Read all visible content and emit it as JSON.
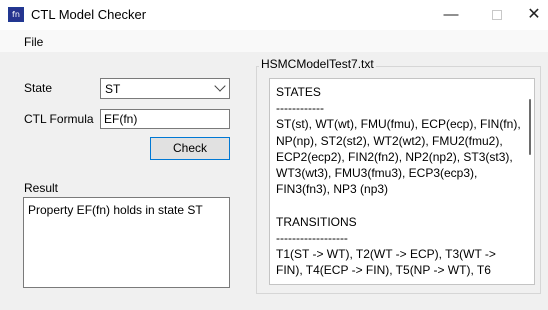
{
  "window": {
    "title": "CTL Model Checker",
    "icon_text": "fn",
    "minimize_glyph": "—",
    "close_glyph": "✕"
  },
  "menu": {
    "file": "File"
  },
  "form": {
    "state_label": "State",
    "state_value": "ST",
    "ctl_formula_label": "CTL Formula",
    "ctl_formula_value": "EF(fn)",
    "check_button": "Check",
    "result_label": "Result",
    "result_text": "Property EF(fn) holds in state ST"
  },
  "model": {
    "file_name": "HSMCModelTest7.txt",
    "content": "STATES\n------------\nST(st), WT(wt), FMU(fmu), ECP(ecp), FIN(fn), NP(np), ST2(st2), WT2(wt2), FMU2(fmu2), ECP2(ecp2), FIN2(fn2), NP2(np2), ST3(st3), WT3(wt3), FMU3(fmu3), ECP3(ecp3), FIN3(fn3), NP3 (np3)\n\nTRANSITIONS\n------------------\nT1(ST -> WT), T2(WT -> ECP), T3(WT -> FIN), T4(ECP -> FIN), T5(NP -> WT), T6"
  }
}
